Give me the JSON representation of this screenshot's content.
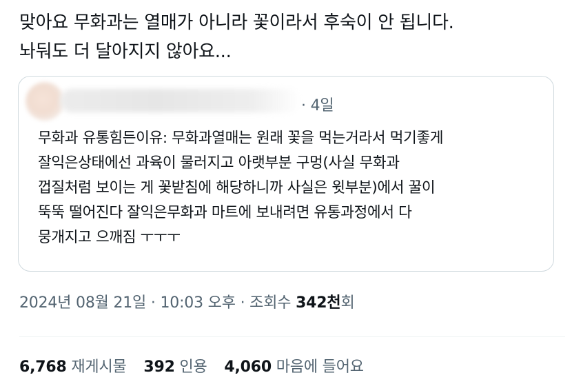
{
  "post": {
    "text": "맞아요 무화과는 열매가 아니라 꽃이라서 후숙이 안 됩니다.\n놔둬도 더 달아지지 않아요...",
    "quoted": {
      "time": "· 4일",
      "text": "무화과 유통힘든이유: 무화과열매는 원래 꽃을 먹는거라서 먹기좋게\n잘익은상태에선 과육이 물러지고 아랫부분 구멍(사실 무화과\n껍질처럼 보이는 게 꽃받침에 해당하니까 사실은 윗부분)에서 꿀이\n뚝뚝 떨어진다 잘익은무화과 마트에 보내려면 유통과정에서 다\n뭉개지고 으깨짐 ㅜㅜㅜ"
    },
    "meta": {
      "date": "2024년 08월 21일",
      "sep1": "·",
      "time": "10:03 오후",
      "sep2": "·",
      "views_label": "조회수",
      "views_num": "342천",
      "views_suffix": "회"
    },
    "stats": {
      "reposts_num": "6,768",
      "reposts_label": "재게시물",
      "quotes_num": "392",
      "quotes_label": "인용",
      "likes_num": "4,060",
      "likes_label": "마음에 들어요"
    }
  },
  "colors": {
    "text_primary": "#0f1419",
    "text_secondary": "#536471",
    "border": "#cfd9de"
  }
}
